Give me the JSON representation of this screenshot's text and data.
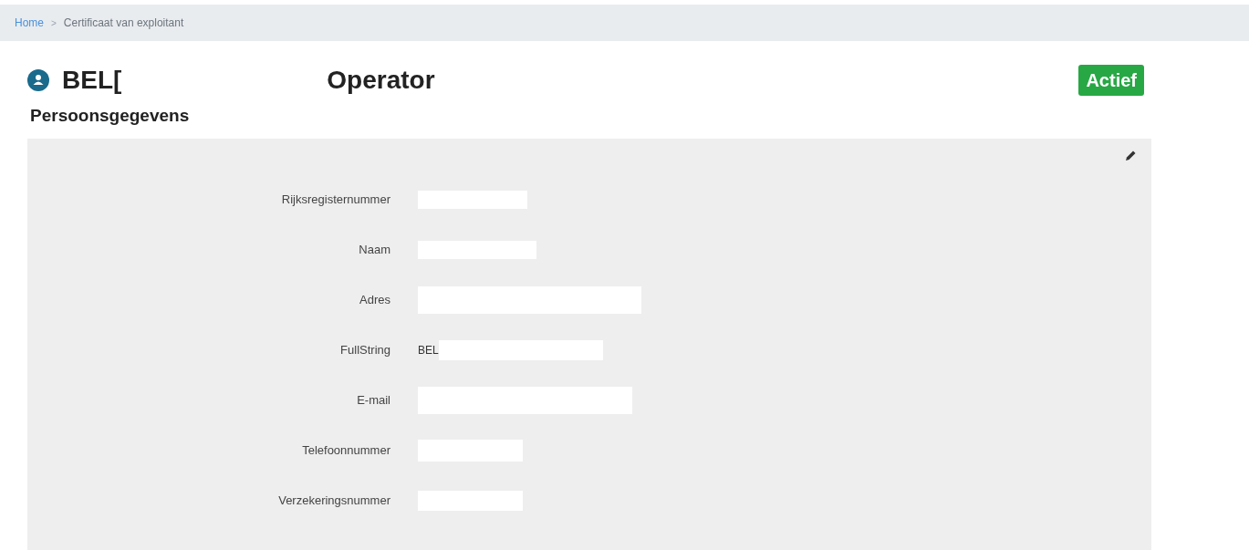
{
  "breadcrumb": [
    {
      "label": "Home",
      "link": true
    },
    {
      "label": "Certificaat van exploitant",
      "link": false
    }
  ],
  "breadcrumb_separator": ">",
  "header": {
    "name": "BEL[",
    "role": "Operator",
    "status": "Actief"
  },
  "section": {
    "title": "Persoonsgegevens"
  },
  "fields": [
    {
      "label": "Rijksregisternummer",
      "redacted": true
    },
    {
      "label": "Naam",
      "redacted": true
    },
    {
      "label": "Adres",
      "redacted": true
    },
    {
      "label": "FullString",
      "value": "BEL",
      "redacted": true
    },
    {
      "label": "E-mail",
      "redacted": true
    },
    {
      "label": "Telefoonnummer",
      "redacted": true
    },
    {
      "label": "Verzekeringsnummer",
      "redacted": true
    }
  ]
}
